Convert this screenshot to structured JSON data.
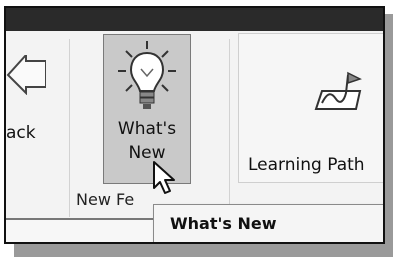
{
  "ribbon": {
    "back_label": "ack",
    "whats_new_line1": "What's",
    "whats_new_line2": "New",
    "group_label": "New Fe",
    "learning_label": "Learning Path"
  },
  "tooltip": {
    "text": "What's New"
  },
  "icons": {
    "back": "arrow-left-icon",
    "whats_new": "lightbulb-icon",
    "learning_path": "flag-path-icon",
    "cursor": "mouse-pointer-icon"
  },
  "colors": {
    "titlebar": "#2a2a2a",
    "ribbon": "#f3f3f3",
    "highlight": "#c9c9c9"
  }
}
